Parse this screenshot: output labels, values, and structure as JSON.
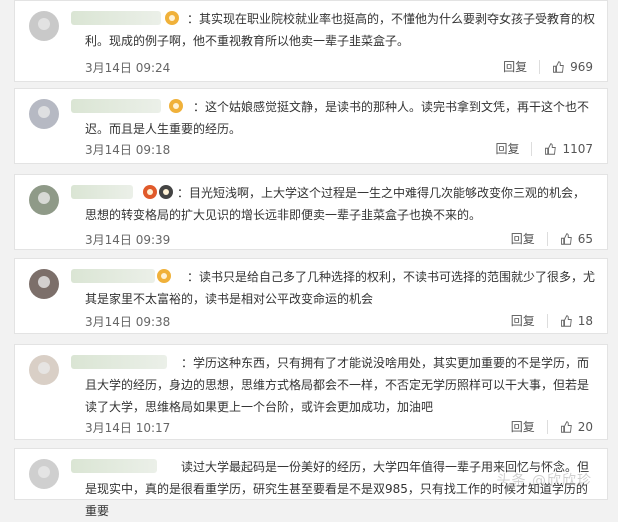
{
  "comments": [
    {
      "text": "：其实现在职业院校就业率也挺高的，不懂他为什么要剥夺女孩子受教育的权利。现成的例子啊，他不重视教育所以他卖一辈子韭菜盒子。",
      "time": "3月14日 09:24",
      "reply": "回复",
      "likes": "969"
    },
    {
      "text": "：这个姑娘感觉挺文静，是读书的那种人。读完书拿到文凭，再干这个也不迟。而且是人生重要的经历。",
      "time": "3月14日 09:18",
      "reply": "回复",
      "likes": "1107"
    },
    {
      "text": "：目光短浅啊，上大学这个过程是一生之中难得几次能够改变你三观的机会，思想的转变格局的扩大见识的增长远非即便卖一辈子韭菜盒子也换不来的。",
      "time": "3月14日 09:39",
      "reply": "回复",
      "likes": "65"
    },
    {
      "text": "：读书只是给自己多了几种选择的权利，不读书可选择的范围就少了很多，尤其是家里不太富裕的，读书是相对公平改变命运的机会",
      "time": "3月14日 09:38",
      "reply": "回复",
      "likes": "18"
    },
    {
      "text": "：学历这种东西，只有拥有了才能说没啥用处，其实更加重要的不是学历，而且大学的经历，身边的思想，思维方式格局都会不一样，不否定无学历照样可以干大事，但若是读了大学，思维格局如果更上一个台阶，或许会更加成功，加油吧",
      "time": "3月14日 10:17",
      "reply": "回复",
      "likes": "20"
    },
    {
      "text": "读过大学最起码是一份美好的经历，大学四年值得一辈子用来回忆与怀念。但是现实中，真的是很看重学历，研究生甚至要看是不是双985，只有找工作的时候才知道学历的重要",
      "time": "",
      "reply": "",
      "likes": ""
    }
  ],
  "watermark": "头条 @欣欣珍",
  "colors": {
    "badge": "#f0b13a",
    "avatar": "#c9c9c9",
    "name_blur": "#d6e2cf"
  }
}
